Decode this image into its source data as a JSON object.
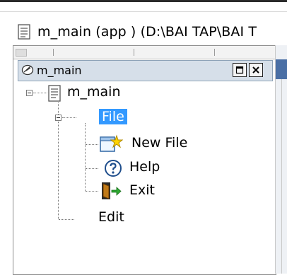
{
  "window": {
    "title": "m_main (app ) (D:\\BAI TAP\\BAI T"
  },
  "panel": {
    "header_title": "m_main",
    "buttons": [
      "restore",
      "close"
    ]
  },
  "tree": {
    "root_label": "m_main",
    "file_label": "File",
    "items": [
      {
        "label": "New File",
        "icon": "new-file-icon"
      },
      {
        "label": "Help",
        "icon": "help-icon"
      },
      {
        "label": "Exit",
        "icon": "exit-icon"
      }
    ],
    "edit_label": "Edit"
  },
  "colors": {
    "selection": "#3399ff",
    "header_bg": "#d6dfe9"
  }
}
